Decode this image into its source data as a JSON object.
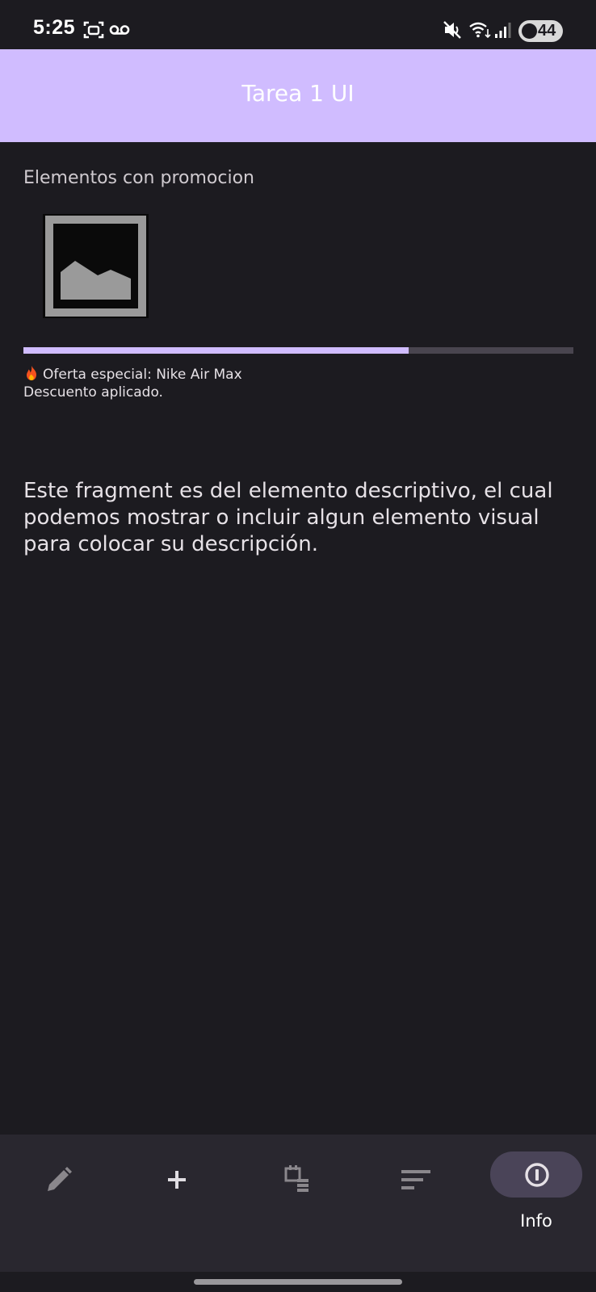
{
  "status_bar": {
    "time": "5:25",
    "battery": "44",
    "icons": [
      "screenshot-icon",
      "voicemail-icon",
      "mute-icon",
      "wifi-icon",
      "signal-icon",
      "battery-icon"
    ]
  },
  "app_bar": {
    "title": "Tarea 1 UI"
  },
  "content": {
    "section_title": "Elementos con promocion",
    "image_icon": "image-placeholder-icon",
    "progress": 0.7,
    "promo_title": "Oferta especial: Nike Air Max",
    "promo_subtitle": "Descuento aplicado.",
    "description": "Este fragment es del elemento descriptivo, el cual podemos mostrar o incluir algun elemento visual para colocar su descripción."
  },
  "bottom_nav": {
    "items": [
      {
        "icon": "pencil-icon"
      },
      {
        "icon": "plus-icon"
      },
      {
        "icon": "calendar-list-icon"
      },
      {
        "icon": "sort-icon"
      },
      {
        "icon": "info-icon",
        "label": "Info",
        "active": true
      }
    ]
  },
  "colors": {
    "background": "#1c1b20",
    "app_bar": "#d0bcff",
    "nav_background": "#29272f",
    "active_pill": "#4a4458",
    "progress_track": "#49454f"
  }
}
